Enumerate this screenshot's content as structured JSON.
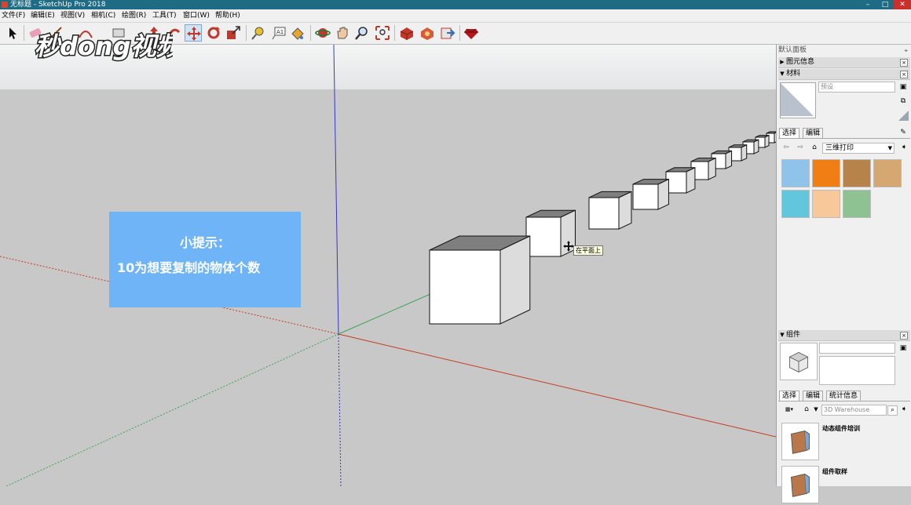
{
  "window": {
    "title": "无标题 - SketchUp Pro 2018",
    "min": "–",
    "max": "□",
    "close": "✕"
  },
  "menu": [
    "文件(F)",
    "编辑(E)",
    "视图(V)",
    "相机(C)",
    "绘图(R)",
    "工具(T)",
    "窗口(W)",
    "帮助(H)"
  ],
  "toolbar": {
    "icons": [
      "select-icon",
      "eraser-icon",
      "line-icon",
      "arc-icon",
      "rectangle-icon",
      "push-pull-icon",
      "follow-me-icon",
      "move-icon",
      "rotate-icon",
      "scale-icon",
      "tape-measure-icon",
      "text-icon",
      "paint-bucket-icon",
      "orbit-icon",
      "pan-icon",
      "zoom-icon",
      "zoom-extents-icon",
      "3d-warehouse-icon",
      "extension-warehouse-icon",
      "send-to-layout-icon",
      "ruby-icon"
    ],
    "active": "move-icon"
  },
  "watermark": {
    "text": "秒dong视频"
  },
  "viewport": {
    "tooltip": "在平面上",
    "colors": {
      "background": "#c8c8c8",
      "sky": "#eef0f0",
      "red_axis": "#c43c1e",
      "green_axis": "#3aa35a",
      "blue_axis": "#3636c8"
    }
  },
  "hint": {
    "title": "小提示：",
    "body": "10为想要复制的物体个数",
    "bg": "#6eb4f7"
  },
  "panel": {
    "tray_title": "默认面板",
    "entity_info": {
      "label": "图元信息",
      "toggle": "▶"
    },
    "materials": {
      "label": "材料",
      "toggle": "▼",
      "name_placeholder": "预设",
      "tabs": [
        "选择",
        "编辑"
      ],
      "library": "三维打印",
      "swatches": [
        "#8fc3ea",
        "#f07e14",
        "#b6834a",
        "#d5a872",
        "#62c6dd",
        "#f6c89a",
        "#8fc293"
      ]
    },
    "components": {
      "label": "组件",
      "toggle": "▼",
      "tabs": [
        "选择",
        "编辑",
        "统计信息"
      ],
      "search_placeholder": "3D Warehouse",
      "items": [
        "动态组件培训",
        "组件取样"
      ]
    }
  }
}
